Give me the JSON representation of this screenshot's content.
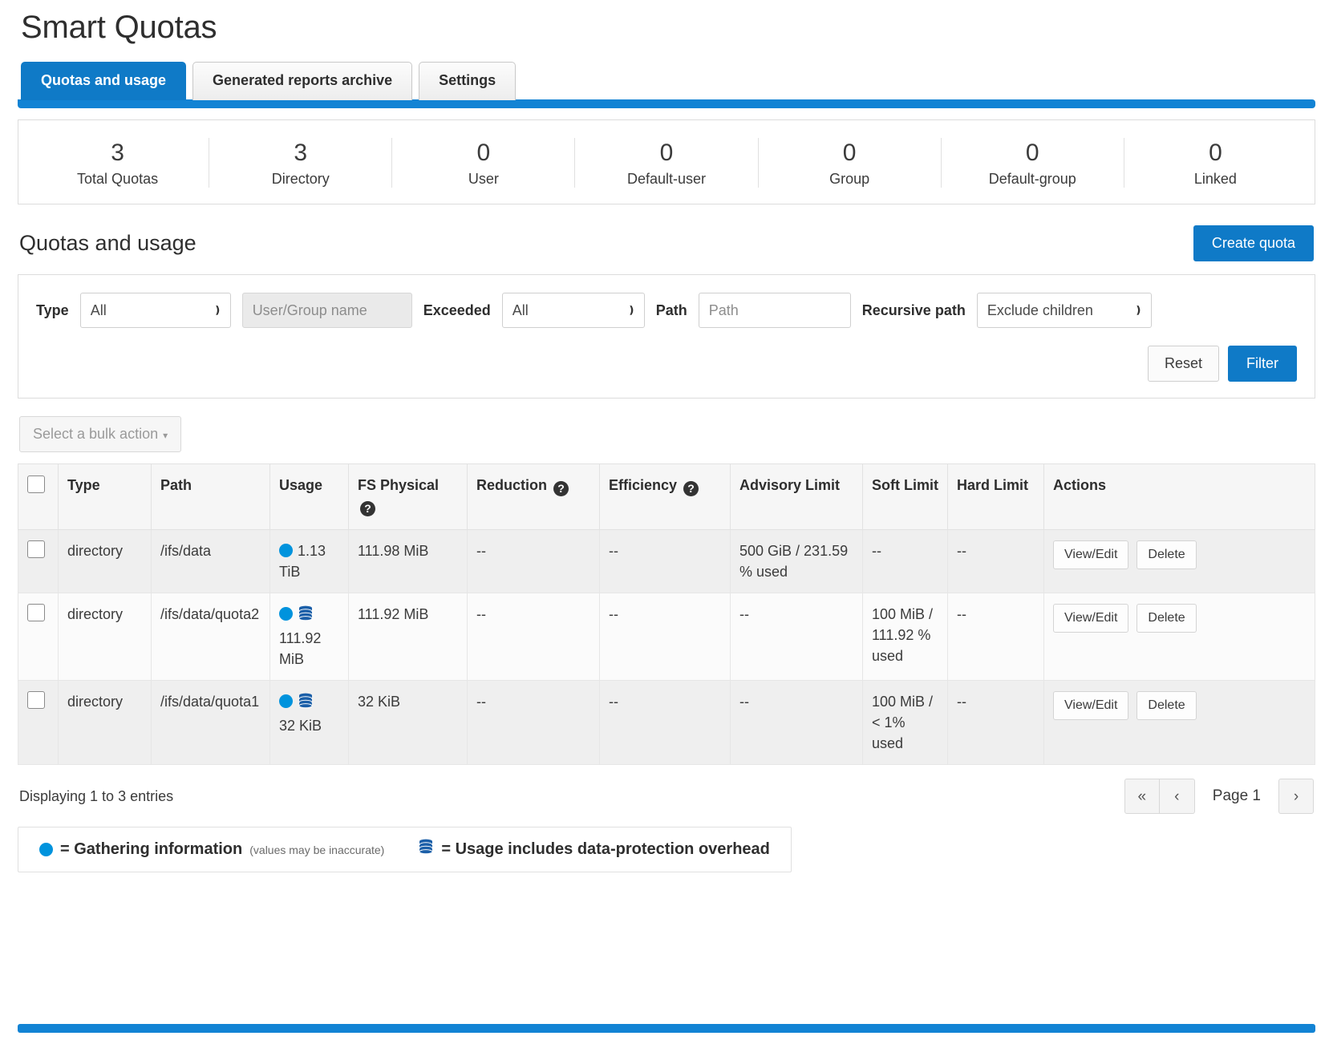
{
  "page": {
    "title": "Smart Quotas"
  },
  "tabs": [
    {
      "label": "Quotas and usage",
      "active": true
    },
    {
      "label": "Generated reports archive",
      "active": false
    },
    {
      "label": "Settings",
      "active": false
    }
  ],
  "summary": [
    {
      "value": "3",
      "label": "Total Quotas"
    },
    {
      "value": "3",
      "label": "Directory"
    },
    {
      "value": "0",
      "label": "User"
    },
    {
      "value": "0",
      "label": "Default-user"
    },
    {
      "value": "0",
      "label": "Group"
    },
    {
      "value": "0",
      "label": "Default-group"
    },
    {
      "value": "0",
      "label": "Linked"
    }
  ],
  "section": {
    "title": "Quotas and usage",
    "create_label": "Create quota"
  },
  "filters": {
    "type_label": "Type",
    "type_value": "All",
    "name_placeholder": "User/Group name",
    "name_value": "",
    "exceeded_label": "Exceeded",
    "exceeded_value": "All",
    "path_label": "Path",
    "path_placeholder": "Path",
    "path_value": "",
    "recursive_label": "Recursive path",
    "recursive_value": "Exclude children",
    "reset_label": "Reset",
    "filter_label": "Filter"
  },
  "bulk": {
    "label": "Select a bulk action"
  },
  "table": {
    "headers": {
      "type": "Type",
      "path": "Path",
      "usage": "Usage",
      "fs_physical": "FS Physical",
      "reduction": "Reduction",
      "efficiency": "Efficiency",
      "advisory_limit": "Advisory Limit",
      "soft_limit": "Soft Limit",
      "hard_limit": "Hard Limit",
      "actions": "Actions"
    },
    "rows": [
      {
        "type": "directory",
        "path": "/ifs/data",
        "usage": "1.13 TiB",
        "usage_gathering": true,
        "usage_overhead": false,
        "fs_physical": "111.98 MiB",
        "reduction": "--",
        "efficiency": "--",
        "advisory_limit": "500 GiB / 231.59 % used",
        "soft_limit": "--",
        "hard_limit": "--",
        "view_label": "View/Edit",
        "delete_label": "Delete"
      },
      {
        "type": "directory",
        "path": "/ifs/data/quota2",
        "usage": "111.92 MiB",
        "usage_gathering": true,
        "usage_overhead": true,
        "fs_physical": "111.92 MiB",
        "reduction": "--",
        "efficiency": "--",
        "advisory_limit": "--",
        "soft_limit": "100 MiB / 111.92 % used",
        "hard_limit": "--",
        "view_label": "View/Edit",
        "delete_label": "Delete"
      },
      {
        "type": "directory",
        "path": "/ifs/data/quota1",
        "usage": "32 KiB",
        "usage_gathering": true,
        "usage_overhead": true,
        "fs_physical": "32 KiB",
        "reduction": "--",
        "efficiency": "--",
        "advisory_limit": "--",
        "soft_limit": "100 MiB / < 1% used",
        "hard_limit": "--",
        "view_label": "View/Edit",
        "delete_label": "Delete"
      }
    ]
  },
  "footer": {
    "entries": "Displaying 1 to 3 entries",
    "page_label": "Page 1",
    "first_glyph": "«",
    "prev_glyph": "‹",
    "next_glyph": "›"
  },
  "legend": {
    "gathering_text": "= Gathering information",
    "gathering_note": "(values may be inaccurate)",
    "overhead_text": "= Usage includes data-protection overhead"
  },
  "colors": {
    "accent": "#0f7ac7",
    "tab_bar": "#1283d4",
    "status_dot": "#0093dd",
    "stack_icon": "#1b5fa8"
  }
}
